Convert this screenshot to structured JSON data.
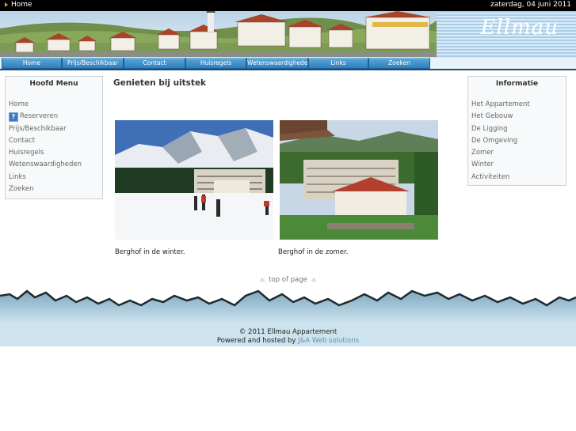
{
  "topbar": {
    "breadcrumb": "Home",
    "date": "zaterdag, 04 juni 2011"
  },
  "header": {
    "logo": "Ellmau"
  },
  "nav": {
    "items": [
      "Home",
      "Prijs/Beschikbaar",
      "Contact",
      "Huisregels",
      "Wetenswaardigheden",
      "Links",
      "Zoeken"
    ]
  },
  "left_menu": {
    "title": "Hoofd Menu",
    "items": [
      "Home",
      "Reserveren",
      "Prijs/Beschikbaar",
      "Contact",
      "Huisregels",
      "Wetenswaardigheden",
      "Links",
      "Zoeken"
    ]
  },
  "right_menu": {
    "title": "Informatie",
    "items": [
      "Het Appartement",
      "Het Gebouw",
      "De Ligging",
      "De Omgeving",
      "Zomer",
      "Winter",
      "Activiteiten"
    ]
  },
  "main": {
    "title": "Genieten bij uitstek",
    "photos": [
      {
        "caption": "Berghof in de winter."
      },
      {
        "caption": "Berghof in de zomer."
      }
    ]
  },
  "top_of_page": "top of page",
  "footer": {
    "copyright": "© 2011 Ellmau Appartement",
    "powered": "Powered and hosted by",
    "link": "J&A Web solutions"
  }
}
